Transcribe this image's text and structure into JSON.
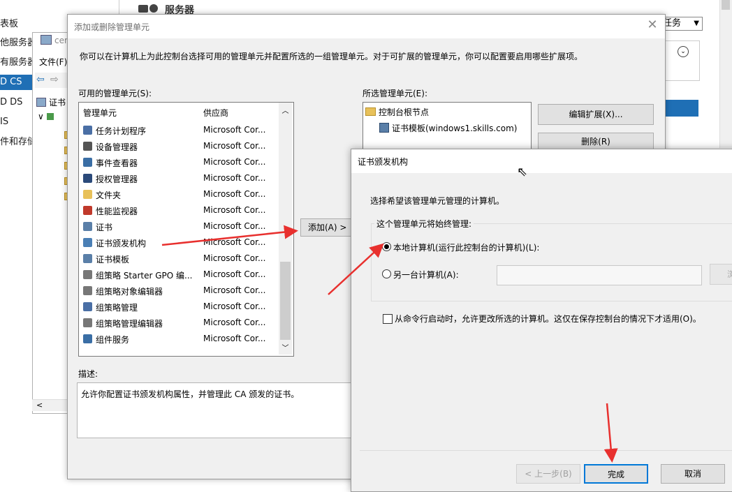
{
  "background_app": {
    "sidebar_items": [
      {
        "label": "表板",
        "selected": false
      },
      {
        "label": "他服务器",
        "selected": false
      },
      {
        "label": "有服务器",
        "selected": false
      },
      {
        "label": "D CS",
        "selected": true
      },
      {
        "label": "D DS",
        "selected": false
      },
      {
        "label": "IS",
        "selected": false
      },
      {
        "label": "件和存储",
        "selected": false
      }
    ],
    "header_title": "服务器",
    "tasks_dropdown": "任务",
    "mmc_title": "cer",
    "mmc_menu_file": "文件(F)",
    "mmc_tree_root": "证书",
    "mmc_tree_child": "∨"
  },
  "snapin_dialog": {
    "title": "添加或删除管理单元",
    "intro": "你可以在计算机上为此控制台选择可用的管理单元并配置所选的一组管理单元。对于可扩展的管理单元，你可以配置要启用哪些扩展项。",
    "available_label": "可用的管理单元(S):",
    "col_snapin": "管理单元",
    "col_vendor": "供应商",
    "available": [
      {
        "name": "任务计划程序",
        "vendor": "Microsoft Cor...",
        "icon": "clock-icon",
        "color": "#4a6fa5"
      },
      {
        "name": "设备管理器",
        "vendor": "Microsoft Cor...",
        "icon": "device-manager-icon",
        "color": "#555555"
      },
      {
        "name": "事件查看器",
        "vendor": "Microsoft Cor...",
        "icon": "event-viewer-icon",
        "color": "#3a6ea5"
      },
      {
        "name": "授权管理器",
        "vendor": "Microsoft Cor...",
        "icon": "authorization-icon",
        "color": "#2b4a7a"
      },
      {
        "name": "文件夹",
        "vendor": "Microsoft Cor...",
        "icon": "folder-icon",
        "color": "#e8c15a"
      },
      {
        "name": "性能监视器",
        "vendor": "Microsoft Cor...",
        "icon": "performance-icon",
        "color": "#c0392b"
      },
      {
        "name": "证书",
        "vendor": "Microsoft Cor...",
        "icon": "certificate-icon",
        "color": "#5a7fa8"
      },
      {
        "name": "证书颁发机构",
        "vendor": "Microsoft Cor...",
        "icon": "certificate-authority-icon",
        "color": "#4a7fb5"
      },
      {
        "name": "证书模板",
        "vendor": "Microsoft Cor...",
        "icon": "certificate-template-icon",
        "color": "#5a7fa8"
      },
      {
        "name": "组策略 Starter GPO 编...",
        "vendor": "Microsoft Cor...",
        "icon": "gpo-icon",
        "color": "#777777"
      },
      {
        "name": "组策略对象编辑器",
        "vendor": "Microsoft Cor...",
        "icon": "gpo-editor-icon",
        "color": "#777777"
      },
      {
        "name": "组策略管理",
        "vendor": "Microsoft Cor...",
        "icon": "gp-management-icon",
        "color": "#4a6fa5"
      },
      {
        "name": "组策略管理编辑器",
        "vendor": "Microsoft Cor...",
        "icon": "gp-management-editor-icon",
        "color": "#777777"
      },
      {
        "name": "组件服务",
        "vendor": "Microsoft Cor...",
        "icon": "component-services-icon",
        "color": "#3a6ea5"
      }
    ],
    "add_button": "添加(A) >",
    "selected_label": "所选管理单元(E):",
    "selected_root": "控制台根节点",
    "selected_child": "证书模板(windows1.skills.com)",
    "edit_ext_button": "编辑扩展(X)...",
    "remove_button": "删除(R)",
    "description_label": "描述:",
    "description": "允许你配置证书颁发机构属性，并管理此 CA 颁发的证书。"
  },
  "ca_dialog": {
    "title": "证书颁发机构",
    "prompt": "选择希望该管理单元管理的计算机。",
    "group_label": "这个管理单元将始终管理:",
    "local_option": "本地计算机(运行此控制台的计算机)(L):",
    "local_selected": true,
    "other_option": "另一台计算机(A):",
    "other_value": "",
    "browse_button": "浏",
    "checkbox_label": "从命令行启动时，允许更改所选的计算机。这仅在保存控制台的情况下才适用(O)。",
    "checkbox_checked": false,
    "back_button": "< 上一步(B)",
    "finish_button": "完成",
    "cancel_button": "取消"
  },
  "colors": {
    "selection_blue": "#1f6fb5",
    "annotation_red": "#e8302e",
    "focus_border": "#0078d7"
  }
}
